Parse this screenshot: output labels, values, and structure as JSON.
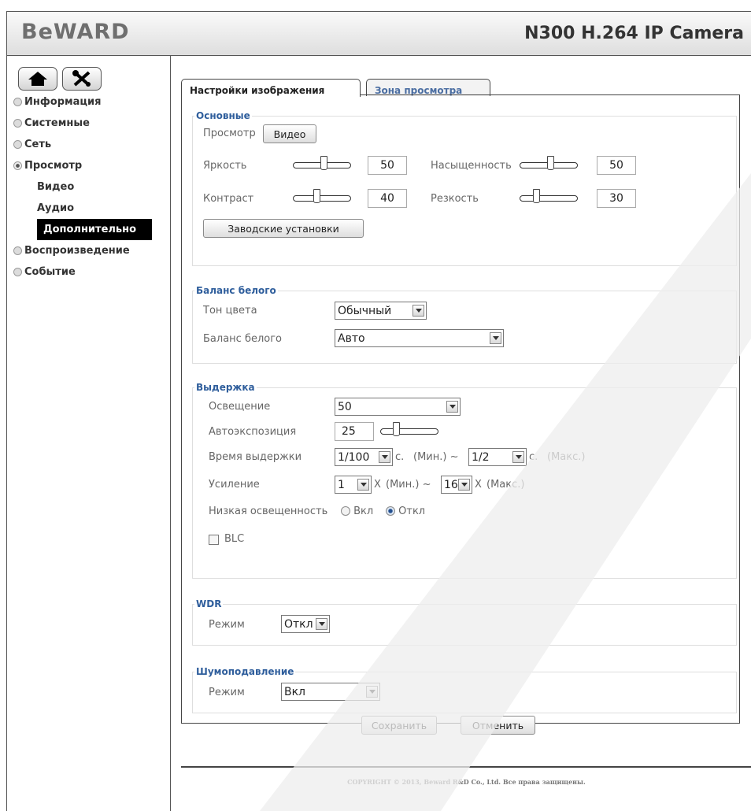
{
  "header": {
    "logo": "BeWARD",
    "model": "N300 H.264 IP Camera"
  },
  "toolbar": {
    "home_icon": "home-icon",
    "settings_icon": "tools-icon"
  },
  "sidebar": {
    "items": [
      {
        "label": "Информация"
      },
      {
        "label": "Системные"
      },
      {
        "label": "Сеть"
      },
      {
        "label": "Просмотр"
      },
      {
        "label": "Видео"
      },
      {
        "label": "Аудио"
      },
      {
        "label": "Дополнительно"
      },
      {
        "label": "Воспроизведение"
      },
      {
        "label": "Событие"
      }
    ]
  },
  "tabs": [
    {
      "label": "Настройки изображения"
    },
    {
      "label": "Зона просмотра"
    }
  ],
  "basic": {
    "legend": "Основные",
    "preview_label": "Просмотр",
    "preview_button": "Видео",
    "brightness_label": "Яркость",
    "brightness": "50",
    "saturation_label": "Насыщенность",
    "saturation": "50",
    "contrast_label": "Контраст",
    "contrast": "40",
    "sharpness_label": "Резкость",
    "sharpness": "30",
    "factory_button": "Заводские установки"
  },
  "wb": {
    "legend": "Баланс белого",
    "tone_label": "Тон цвета",
    "tone": "Обычный",
    "wb_label": "Баланс белого",
    "wb": "Авто"
  },
  "exposure": {
    "legend": "Выдержка",
    "light_label": "Освещение",
    "light": "50",
    "ae_label": "Автоэкспозиция",
    "ae": "25",
    "shutter_label": "Время выдержки",
    "shutter_min": "1/100",
    "unit_s": "с.",
    "min_text": "(Мин.) ~",
    "shutter_max": "1/2",
    "max_text": "(Макс.)",
    "gain_label": "Усиление",
    "gain_min": "1",
    "unit_x": "X",
    "gain_max": "16",
    "lowlux_label": "Низкая освещенность",
    "on": "Вкл",
    "off": "Откл",
    "blc": "BLC"
  },
  "wdr": {
    "legend": "WDR",
    "mode_label": "Режим",
    "mode": "Откл"
  },
  "nr": {
    "legend": "Шумоподавление",
    "mode_label": "Режим",
    "mode": "Вкл"
  },
  "actions": {
    "save": "Сохранить",
    "cancel": "Отменить"
  },
  "footer": {
    "copyright": "COPYRIGHT © 2013, Beward R&D Co., Ltd. Все права защищены."
  },
  "colors": {
    "accent": "#2f5e9c",
    "active_nav_bg": "#000000",
    "watermark": "#f0f0f0"
  }
}
